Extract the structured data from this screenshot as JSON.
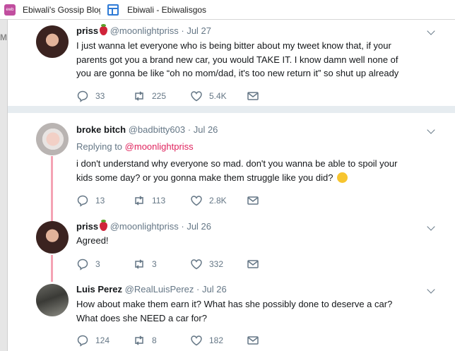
{
  "bookmarks": [
    {
      "icon": "gossip-favicon",
      "label": "Ebiwali's Gossip Blog"
    },
    {
      "icon": "page-favicon",
      "label": "Ebiwali - Ebiwalisgos"
    }
  ],
  "gutter": {
    "top_letter": "M"
  },
  "tweets": [
    {
      "name": "priss",
      "name_emoji": "strawberry",
      "handle": "@moonlightpriss",
      "date": "Jul 27",
      "reply_prefix": "",
      "reply_to": "",
      "lines": [
        "I just wanna let everyone who is being bitter about my tweet know that, if your",
        "parents got you a brand new car, you would TAKE IT. I know damn well none of",
        "you are gonna be like “oh no mom/dad, it's too new return it” so shut up already"
      ],
      "replies": "33",
      "retweets": "225",
      "likes": "5.4K"
    },
    {
      "name": "broke bitch",
      "handle": "@badbitty603",
      "date": "Jul 26",
      "reply_prefix": "Replying to",
      "reply_to": "@moonlightpriss",
      "lines": [
        "i don't understand why everyone so mad. don't you wanna be able to spoil your",
        "kids some day? or you gonna make them struggle like you did?"
      ],
      "text_emoji": "eye-roll-emoji",
      "replies": "13",
      "retweets": "113",
      "likes": "2.8K"
    },
    {
      "name": "priss",
      "name_emoji": "strawberry",
      "handle": "@moonlightpriss",
      "date": "Jul 26",
      "lines": [
        "Agreed!"
      ],
      "replies": "3",
      "retweets": "3",
      "likes": "332"
    },
    {
      "name": "Luis Perez",
      "handle": "@RealLuisPerez",
      "date": "Jul 26",
      "lines": [
        "How about make them earn it? What has she possibly done to deserve a car?",
        "What does she NEED a car for?"
      ],
      "replies": "124",
      "retweets": "8",
      "likes": "182"
    }
  ],
  "colors": {
    "link": "#e0245e",
    "meta": "#657786",
    "thread": "#f4a3b4",
    "separator": "#e6ecf0"
  }
}
